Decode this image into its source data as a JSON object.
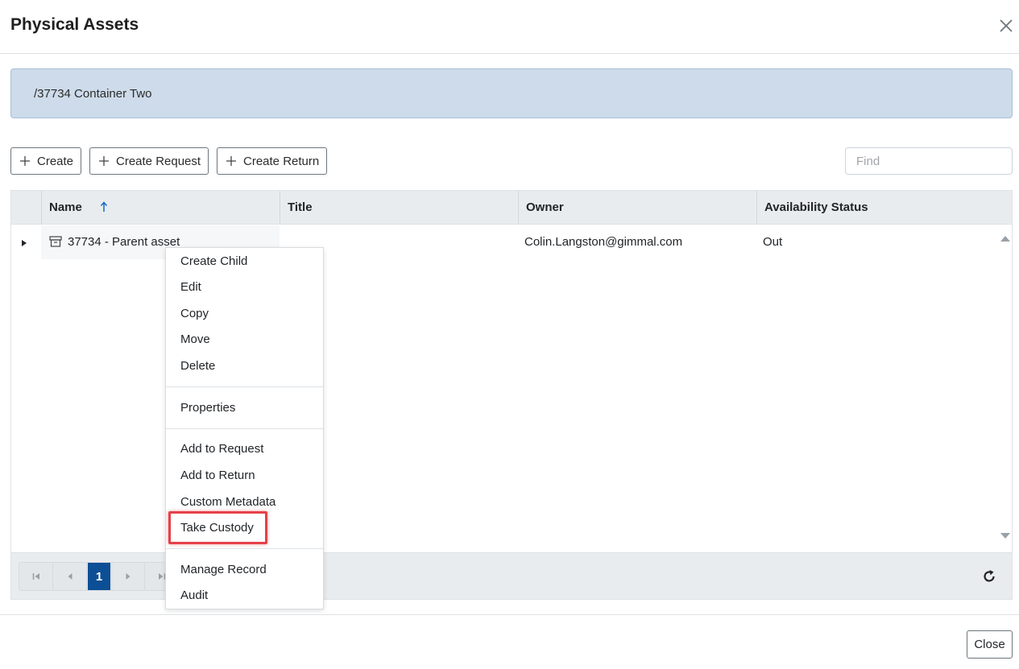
{
  "dialog": {
    "title": "Physical Assets",
    "close_icon": "close-x-icon"
  },
  "path_banner": {
    "text": "/37734 Container Two"
  },
  "toolbar": {
    "create_label": "Create",
    "create_request_label": "Create Request",
    "create_return_label": "Create Return",
    "find_placeholder": "Find",
    "plus_icon": "plus-icon"
  },
  "grid": {
    "columns": [
      {
        "label": "Name",
        "sorted": "ascending"
      },
      {
        "label": "Title"
      },
      {
        "label": "Owner"
      },
      {
        "label": "Availability Status"
      }
    ],
    "rows": [
      {
        "name": "37734 - Parent asset",
        "title": "",
        "owner": "Colin.Langston@gimmal.com",
        "availability_status": "Out",
        "icon": "archive-box-icon",
        "expanded": false
      }
    ]
  },
  "context_menu": {
    "items": [
      {
        "label": "Create Child"
      },
      {
        "label": "Edit"
      },
      {
        "label": "Copy"
      },
      {
        "label": "Move"
      },
      {
        "label": "Delete"
      },
      {
        "label": "Properties"
      },
      {
        "label": "Add to Request"
      },
      {
        "label": "Add to Return"
      },
      {
        "label": "Custom Metadata"
      },
      {
        "label": "Take Custody",
        "highlighted": true
      },
      {
        "label": "Manage Record"
      },
      {
        "label": "Audit"
      }
    ],
    "highlight_color": "#e5404a"
  },
  "pager": {
    "current_page": "1",
    "active_color": "#0d4f96"
  },
  "footer": {
    "close_label": "Close"
  },
  "colors": {
    "banner_bg": "#cddbea",
    "grid_header_bg": "#e9ecef"
  }
}
